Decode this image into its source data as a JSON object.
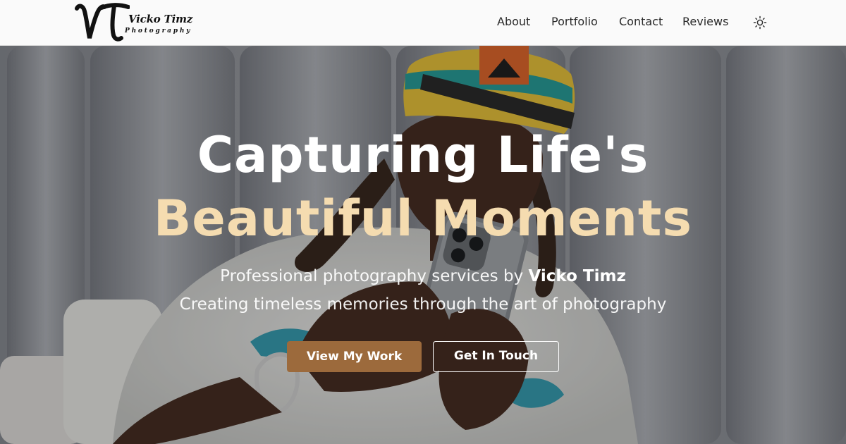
{
  "brand": {
    "name": "Vicko Timz",
    "subtitle": "Photography",
    "monogram": "VT"
  },
  "nav": {
    "items": [
      {
        "label": "About"
      },
      {
        "label": "Portfolio"
      },
      {
        "label": "Contact"
      },
      {
        "label": "Reviews"
      }
    ],
    "theme_toggle_icon": "sun-icon"
  },
  "hero": {
    "title_line1": "Capturing Life's",
    "title_line2": "Beautiful Moments",
    "subtitle_prefix": "Professional photography services by ",
    "subtitle_name": "Vicko Timz",
    "tagline": "Creating timeless memories through the art of photography",
    "primary_button": "View My Work",
    "secondary_button": "Get In Touch"
  },
  "colors": {
    "accent": "#9c6a3c",
    "title_highlight": "#f5dcb0"
  }
}
